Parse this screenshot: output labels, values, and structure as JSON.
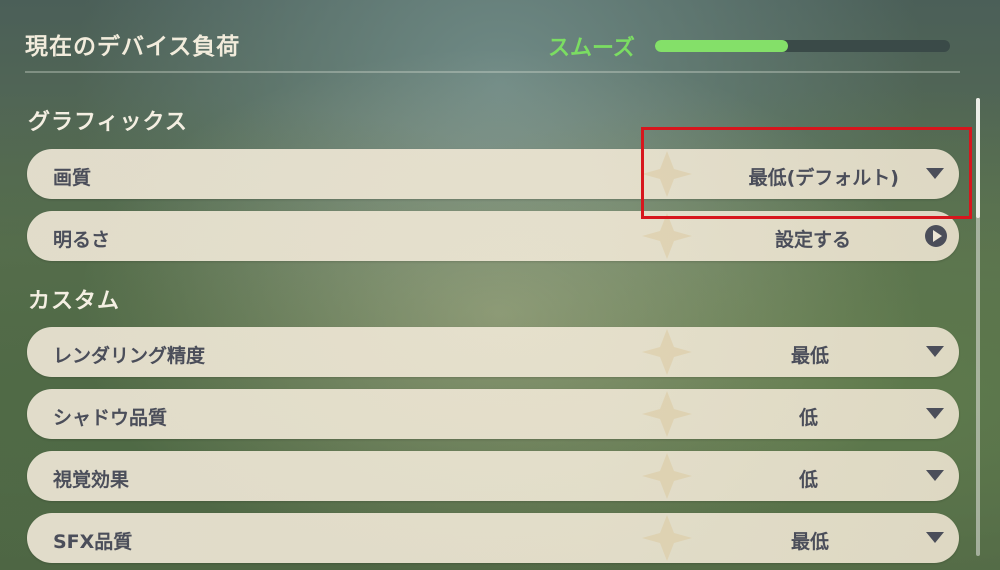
{
  "header": {
    "title": "現在のデバイス負荷",
    "load_status": "スムーズ",
    "load_fraction": 0.45
  },
  "sections": {
    "graphics": {
      "title": "グラフィックス",
      "quality": {
        "label": "画質",
        "value": "最低(デフォルト)"
      },
      "brightness": {
        "label": "明るさ",
        "value": "設定する"
      }
    },
    "custom": {
      "title": "カスタム",
      "rendering": {
        "label": "レンダリング精度",
        "value": "最低"
      },
      "shadow": {
        "label": "シャドウ品質",
        "value": "低"
      },
      "visual": {
        "label": "視覚効果",
        "value": "低"
      },
      "sfx": {
        "label": "SFX品質",
        "value": "最低"
      }
    }
  },
  "colors": {
    "status_green": "#7bdd62",
    "row_background": "#ece5d4",
    "row_text": "#4b4e5a",
    "highlight_red": "#d7161d"
  }
}
